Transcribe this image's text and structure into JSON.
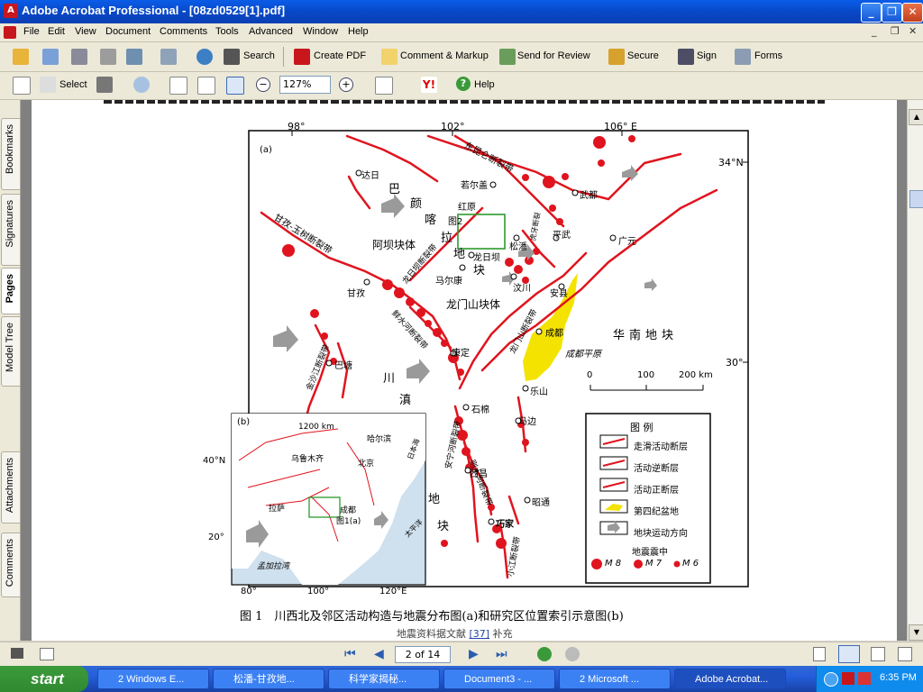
{
  "window": {
    "title": "Adobe Acrobat Professional - [08zd0529[1].pdf]",
    "app_icon": "acrobat-icon"
  },
  "menu": [
    "File",
    "Edit",
    "View",
    "Document",
    "Comments",
    "Tools",
    "Advanced",
    "Window",
    "Help"
  ],
  "toolbar1": {
    "search": "Search",
    "create_pdf": "Create PDF",
    "comment_markup": "Comment & Markup",
    "send_review": "Send for Review",
    "secure": "Secure",
    "sign": "Sign",
    "forms": "Forms"
  },
  "toolbar2": {
    "select": "Select",
    "zoom": "127%",
    "help": "Help"
  },
  "nav_tabs": [
    "Bookmarks",
    "Signatures",
    "Pages",
    "Model Tree",
    "Attachments",
    "Comments"
  ],
  "map": {
    "panel_a": "(a)",
    "panel_b": "(b)",
    "lon_labels": [
      "98°",
      "102°",
      "106° E"
    ],
    "lat_labels": [
      "34°N",
      "30°"
    ],
    "inset_lon": [
      "80°",
      "100°",
      "120°E"
    ],
    "inset_lat": [
      "40°N",
      "20°"
    ],
    "places": [
      "达日",
      "若尔盖",
      "红原",
      "武都",
      "平武",
      "广元",
      "松潘",
      "龙日坝",
      "马尔康",
      "汶川",
      "安县",
      "甘孜",
      "成都",
      "康定",
      "巴塘",
      "乐山",
      "石棉",
      "马边",
      "西昌",
      "昭通",
      "巧家"
    ],
    "regions": [
      "巴",
      "颜",
      "喀",
      "拉",
      "阿坝块体",
      "地",
      "块",
      "龙门山块体",
      "华南地块",
      "川",
      "滇",
      "地",
      "块"
    ],
    "faults": [
      "东昆仑断裂带",
      "甘孜-玉树断裂带",
      "龙日坝断裂带",
      "鲜水河断裂带",
      "金沙江断裂带",
      "龙门山断裂带",
      "安宁河断裂带",
      "则木河断裂带",
      "小江断裂带",
      "虎牙断裂"
    ],
    "feature_labels": [
      "图2",
      "成都平原"
    ],
    "scale": {
      "zero": "0",
      "mid": "100",
      "max": "200 km"
    },
    "inset": {
      "scale": "1200 km",
      "cities": [
        "乌鲁木齐",
        "哈尔滨",
        "北京",
        "拉萨",
        "成都"
      ],
      "ref": "图1(a)",
      "sea1": "日本海",
      "sea2": "太平洋",
      "sea3": "孟加拉湾"
    },
    "legend": {
      "title": "图  例",
      "items": [
        "走滑活动断层",
        "活动逆断层",
        "活动正断层",
        "第四纪盆地",
        "地块运动方向"
      ],
      "eq_title": "地震震中",
      "eq_sizes": [
        "M 8",
        "M 7",
        "M 6"
      ]
    }
  },
  "caption": "图 1　川西北及邻区活动构造与地震分布图(a)和研究区位置索引示意图(b)",
  "source_note": {
    "text": "地震资料据文献",
    "ref": "[37]",
    "tail": "补充"
  },
  "status": {
    "page": "2 of 14"
  },
  "taskbar": {
    "start": "start",
    "tasks": [
      "2 Windows E...",
      "松潘-甘孜地...",
      "科学家揭秘...",
      "Document3 - ...",
      "2 Microsoft ...",
      "Adobe Acrobat..."
    ],
    "clock": "6:35 PM"
  },
  "colors": {
    "fault_red": "#e0141e",
    "basin_yellow": "#f4e300",
    "titlebar": "#0a5de8"
  }
}
